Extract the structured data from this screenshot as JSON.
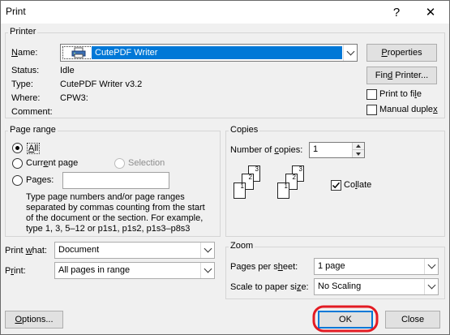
{
  "window": {
    "title": "Print",
    "help_glyph": "?",
    "close_glyph": "✕"
  },
  "printer": {
    "group_label": "Printer",
    "name_label": "Name:",
    "selected_printer": "CutePDF Writer",
    "status_label": "Status:",
    "status_value": "Idle",
    "type_label": "Type:",
    "type_value": "CutePDF Writer v3.2",
    "where_label": "Where:",
    "where_value": "CPW3:",
    "comment_label": "Comment:",
    "comment_value": "",
    "properties_button": "Properties",
    "find_printer_button": "Find Printer...",
    "print_to_file_label": "Print to file",
    "manual_duplex_label": "Manual duplex"
  },
  "page_range": {
    "group_label": "Page range",
    "all_label": "All",
    "current_page_label": "Current page",
    "selection_label": "Selection",
    "pages_label": "Pages:",
    "pages_value": "",
    "help_line_1": "Type page numbers and/or page ranges",
    "help_line_2": "separated by commas counting from the start",
    "help_line_3": "of the document or the section. For example,",
    "help_line_4": "type 1, 3, 5–12 or p1s1, p1s2, p1s3–p8s3"
  },
  "copies": {
    "group_label": "Copies",
    "number_label": "Number of copies:",
    "number_value": "1",
    "collate_label": "Collate",
    "collate_checked": true,
    "page_numbers": [
      "3",
      "2",
      "1"
    ]
  },
  "print_what": {
    "label": "Print what:",
    "value": "Document"
  },
  "print_range": {
    "label": "Print:",
    "value": "All pages in range"
  },
  "zoom": {
    "group_label": "Zoom",
    "pages_per_sheet_label": "Pages per sheet:",
    "pages_per_sheet_value": "1 page",
    "scale_label": "Scale to paper size:",
    "scale_value": "No Scaling"
  },
  "footer": {
    "options_button": "Options...",
    "ok_button": "OK",
    "close_button": "Close"
  },
  "colors": {
    "selection": "#0078d7",
    "annotation_circle": "#e31b23"
  }
}
